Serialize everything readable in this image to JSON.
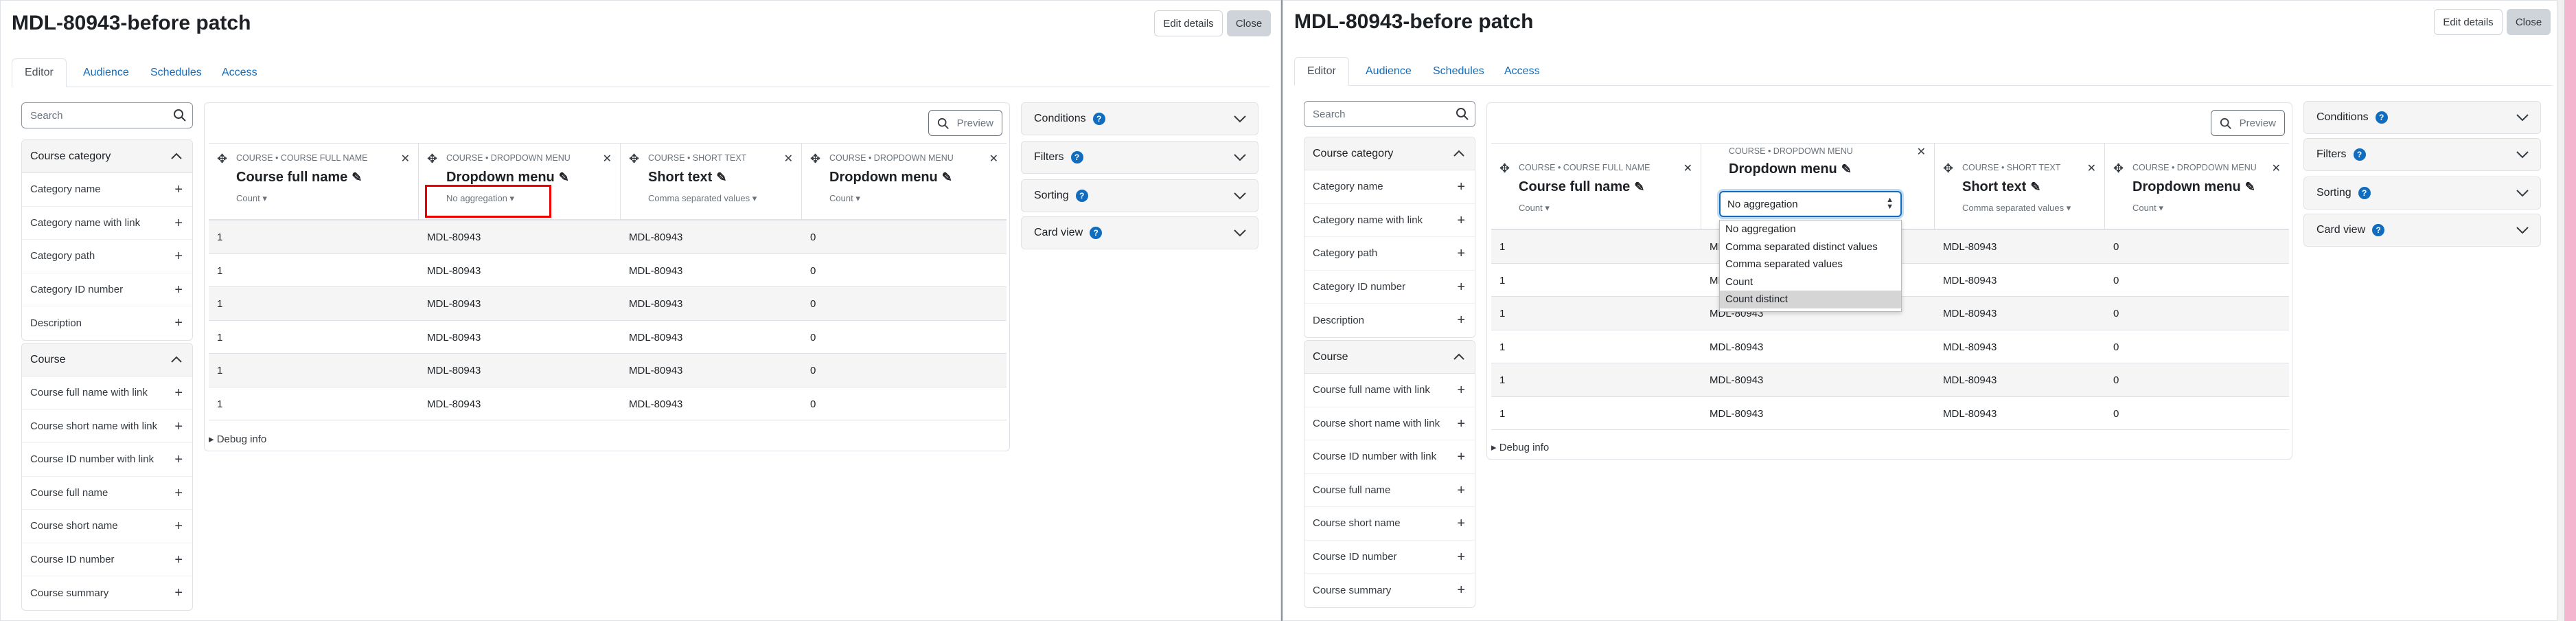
{
  "page_title": "MDL-80943-before patch",
  "buttons": {
    "edit_details": "Edit details",
    "close": "Close"
  },
  "tabs": [
    "Editor",
    "Audience",
    "Schedules",
    "Access"
  ],
  "search_placeholder": "Search",
  "sidebar": {
    "course_category": {
      "title": "Course category",
      "items": [
        "Category name",
        "Category name with link",
        "Category path",
        "Category ID number",
        "Description"
      ]
    },
    "course": {
      "title": "Course",
      "items": [
        "Course full name with link",
        "Course short name with link",
        "Course ID number with link",
        "Course full name",
        "Course short name",
        "Course ID number",
        "Course summary"
      ]
    }
  },
  "preview_label": "Preview",
  "columns": [
    {
      "context": "Course • Course full name",
      "name": "Course full name",
      "aggregation": "Count"
    },
    {
      "context": "Course • Dropdown menu",
      "name": "Dropdown menu",
      "aggregation": "No aggregation"
    },
    {
      "context": "Course • Short text",
      "name": "Short text",
      "aggregation": "Comma separated values"
    },
    {
      "context": "Course • Dropdown menu",
      "name": "Dropdown menu",
      "aggregation": "Count"
    }
  ],
  "rows": [
    [
      "1",
      "MDL-80943",
      "MDL-80943",
      "0"
    ],
    [
      "1",
      "MDL-80943",
      "MDL-80943",
      "0"
    ],
    [
      "1",
      "MDL-80943",
      "MDL-80943",
      "0"
    ],
    [
      "1",
      "MDL-80943",
      "MDL-80943",
      "0"
    ],
    [
      "1",
      "MDL-80943",
      "MDL-80943",
      "0"
    ],
    [
      "1",
      "MDL-80943",
      "MDL-80943",
      "0"
    ]
  ],
  "debug_label": "Debug info",
  "right_cards": [
    "Conditions",
    "Filters",
    "Sorting",
    "Card view"
  ],
  "dropdown": {
    "selected": "No aggregation",
    "options": [
      "No aggregation",
      "Comma separated distinct values",
      "Comma separated values",
      "Count",
      "Count distinct"
    ],
    "hovered": "Count distinct"
  },
  "colors": {
    "link": "#0f6cbf",
    "highlight": "#ee0000"
  }
}
